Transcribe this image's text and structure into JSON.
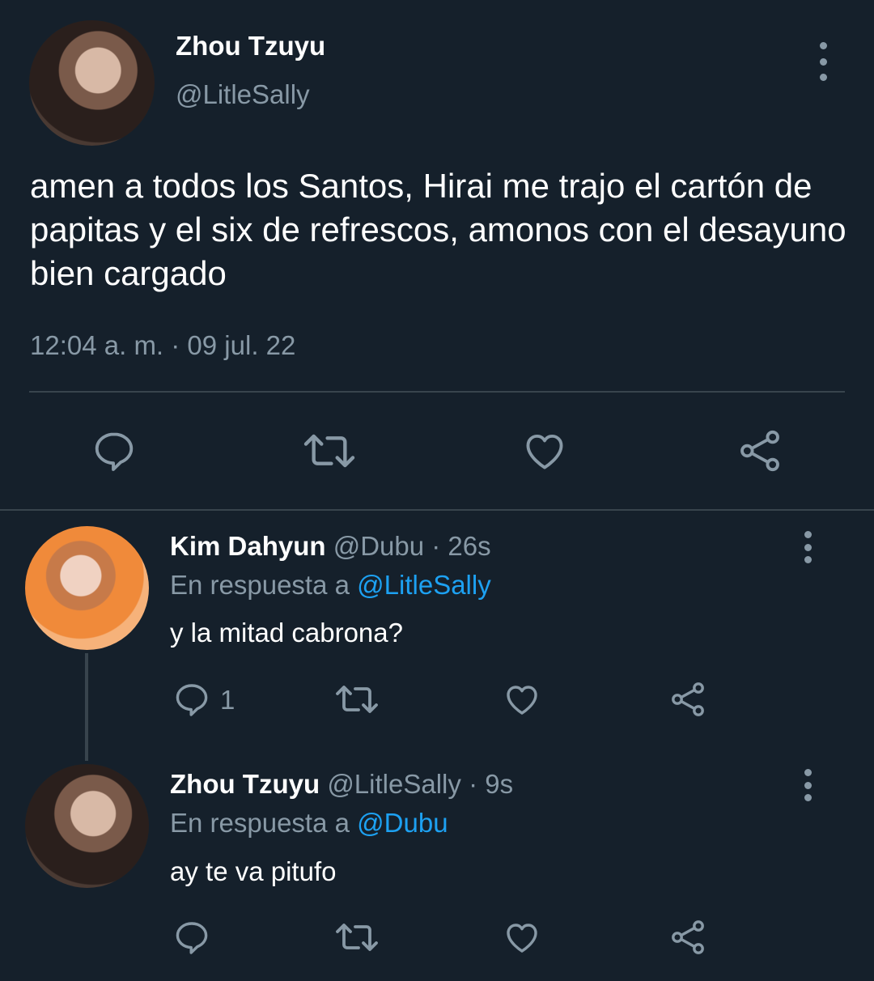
{
  "main_tweet": {
    "author_name": "Zhou Tzuyu",
    "author_handle": "@LitleSally",
    "text": "amen a todos los Santos, Hirai me trajo el cartón de papitas y el six de refrescos, amonos con el desayuno bien cargado",
    "timestamp": "12:04 a. m. · 09 jul. 22",
    "actions": [
      "reply-icon",
      "retweet-icon",
      "like-icon",
      "share-icon"
    ]
  },
  "replies": [
    {
      "author_name": "Kim Dahyun",
      "author_handle": "@Dubu",
      "time": "· 26s",
      "replying_prefix": "En respuesta a",
      "replying_to": "@LitleSally",
      "text": "y la mitad cabrona?",
      "reply_count": "1"
    },
    {
      "author_name": "Zhou Tzuyu",
      "author_handle": "@LitleSally",
      "time": "· 9s",
      "replying_prefix": "En respuesta a",
      "replying_to": "@Dubu",
      "text": "ay te va pitufo",
      "reply_count": ""
    }
  ],
  "colors": {
    "background": "#15202b",
    "secondary_text": "#8899a6",
    "link": "#1da1f2",
    "divider": "#38444d"
  }
}
